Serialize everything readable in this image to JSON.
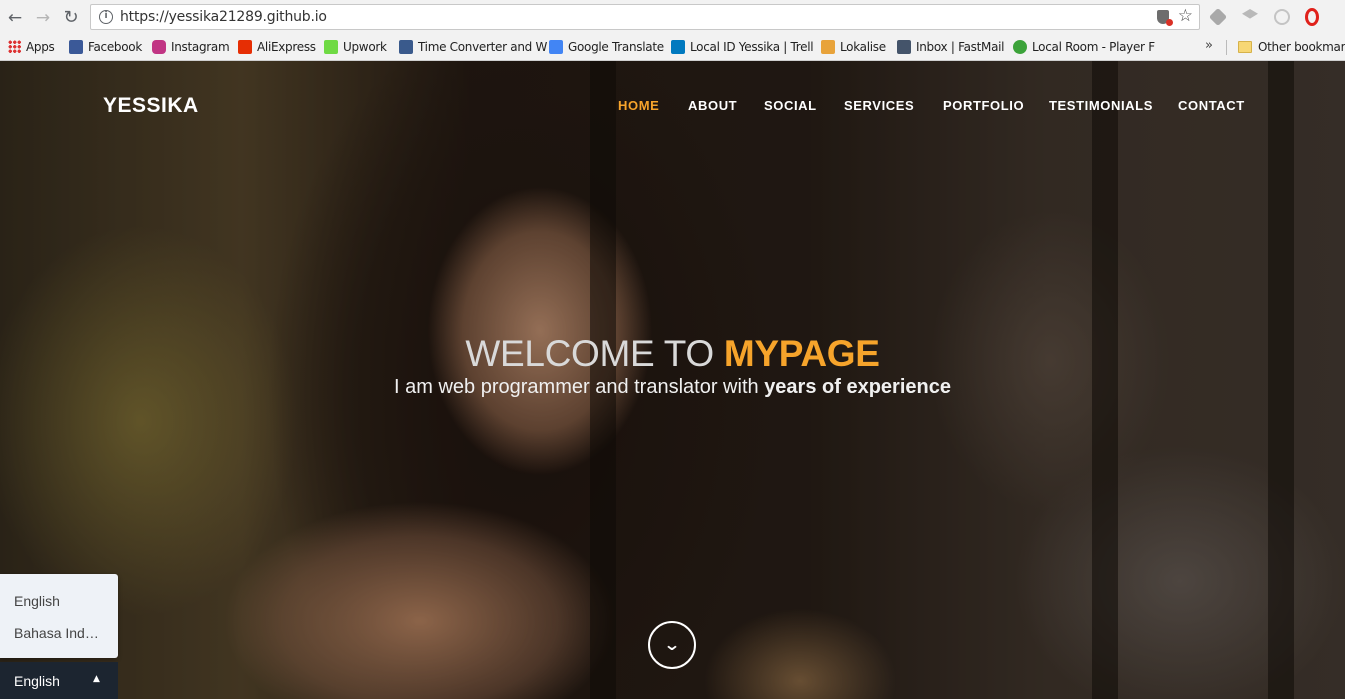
{
  "browser": {
    "url": "https://yessika21289.github.io",
    "bookmarks": [
      {
        "label": "Apps",
        "icon": "apps-grid-icon"
      },
      {
        "label": "Facebook",
        "icon": "facebook-icon",
        "color": "#3b5998"
      },
      {
        "label": "Instagram",
        "icon": "instagram-icon",
        "color": "#c13584"
      },
      {
        "label": "AliExpress",
        "icon": "aliexpress-icon",
        "color": "#e62e04"
      },
      {
        "label": "Upwork",
        "icon": "upwork-icon",
        "color": "#6fda44"
      },
      {
        "label": "Time Converter and W",
        "icon": "time-converter-icon",
        "color": "#3a5a8c"
      },
      {
        "label": "Google Translate",
        "icon": "google-translate-icon",
        "color": "#4285f4"
      },
      {
        "label": "Local ID Yessika | Trell",
        "icon": "trello-icon",
        "color": "#0079bf"
      },
      {
        "label": "Lokalise",
        "icon": "lokalise-icon",
        "color": "#e8a33a"
      },
      {
        "label": "Inbox | FastMail",
        "icon": "mail-icon",
        "color": "#44546a"
      },
      {
        "label": "Local Room - Player F",
        "icon": "local-room-icon",
        "color": "#3ca33a"
      }
    ],
    "overflow_chevron": "»",
    "other_bookmarks": "Other bookmark"
  },
  "site": {
    "brand": "YESSIKA",
    "nav": [
      "HOME",
      "ABOUT",
      "SOCIAL",
      "SERVICES",
      "PORTFOLIO",
      "TESTIMONIALS",
      "CONTACT"
    ],
    "active_nav": "HOME",
    "accent_color": "#f6a42b"
  },
  "hero": {
    "welcome_prefix": "WELCOME TO ",
    "welcome_highlight": "MYPAGE",
    "tagline_prefix": "I am web programmer and translator with ",
    "tagline_bold": "years of experience",
    "scroll_icon": "chevron-down-icon"
  },
  "language": {
    "options": [
      "English",
      "Bahasa Indonesia"
    ],
    "current": "English",
    "caret": "▲"
  }
}
